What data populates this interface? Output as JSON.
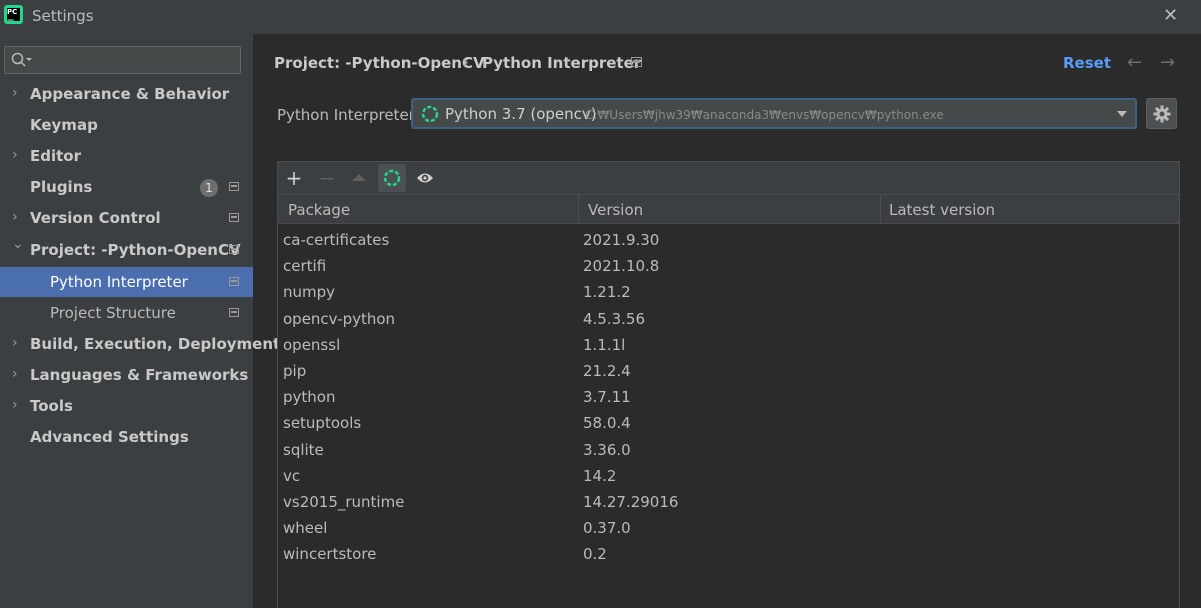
{
  "window": {
    "title": "Settings"
  },
  "search": {
    "placeholder": ""
  },
  "sidebar": {
    "items": [
      {
        "label": "Appearance & Behavior",
        "expandable": true
      },
      {
        "label": "Keymap",
        "expandable": false
      },
      {
        "label": "Editor",
        "expandable": true
      },
      {
        "label": "Plugins",
        "expandable": false,
        "badge": "1"
      },
      {
        "label": "Version Control",
        "expandable": true
      },
      {
        "label": "Project: -Python-OpenCV",
        "expandable": true,
        "expanded": true
      },
      {
        "label": "Python Interpreter",
        "selected": true,
        "child": true
      },
      {
        "label": "Project Structure",
        "child": true
      },
      {
        "label": "Build, Execution, Deployment",
        "expandable": true
      },
      {
        "label": "Languages & Frameworks",
        "expandable": true
      },
      {
        "label": "Tools",
        "expandable": true
      },
      {
        "label": "Advanced Settings",
        "expandable": false
      }
    ]
  },
  "header": {
    "breadcrumb_project": "Project: -Python-OpenCV",
    "breadcrumb_page": "Python Interpreter",
    "reset_label": "Reset"
  },
  "interpreter": {
    "label": "Python Interpreter:",
    "name": "Python 3.7 (opencv)",
    "path": "C:₩Users₩jhw39₩anaconda3₩envs₩opencv₩python.exe"
  },
  "table": {
    "columns": [
      "Package",
      "Version",
      "Latest version"
    ],
    "rows": [
      {
        "package": "ca-certificates",
        "version": "2021.9.30",
        "latest": ""
      },
      {
        "package": "certifi",
        "version": "2021.10.8",
        "latest": ""
      },
      {
        "package": "numpy",
        "version": "1.21.2",
        "latest": ""
      },
      {
        "package": "opencv-python",
        "version": "4.5.3.56",
        "latest": ""
      },
      {
        "package": "openssl",
        "version": "1.1.1l",
        "latest": ""
      },
      {
        "package": "pip",
        "version": "21.2.4",
        "latest": ""
      },
      {
        "package": "python",
        "version": "3.7.11",
        "latest": ""
      },
      {
        "package": "setuptools",
        "version": "58.0.4",
        "latest": ""
      },
      {
        "package": "sqlite",
        "version": "3.36.0",
        "latest": ""
      },
      {
        "package": "vc",
        "version": "14.2",
        "latest": ""
      },
      {
        "package": "vs2015_runtime",
        "version": "14.27.29016",
        "latest": ""
      },
      {
        "package": "wheel",
        "version": "0.37.0",
        "latest": ""
      },
      {
        "package": "wincertstore",
        "version": "0.2",
        "latest": ""
      }
    ]
  },
  "colors": {
    "accent": "#4b6eaf",
    "link": "#589df6",
    "spinner": "#21d789"
  },
  "icons": [
    "pycharm-logo-icon",
    "close-icon",
    "search-icon",
    "chevron-right-icon",
    "chevron-down-icon",
    "project-level-icon",
    "layout-icon",
    "back-arrow-icon",
    "forward-arrow-icon",
    "spinner-icon",
    "dropdown-arrow-icon",
    "gear-icon",
    "add-icon",
    "remove-icon",
    "upgrade-icon",
    "eye-icon"
  ]
}
